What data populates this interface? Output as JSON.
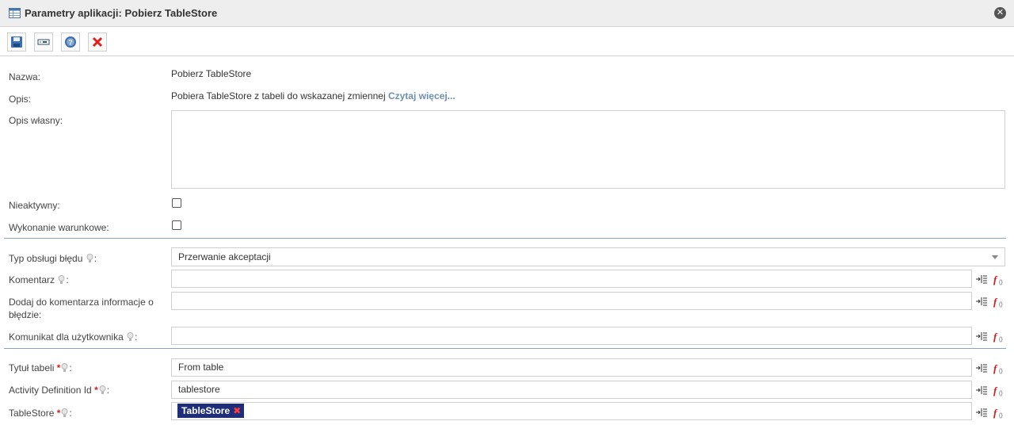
{
  "window": {
    "title": "Parametry aplikacji: Pobierz TableStore",
    "close_glyph": "✕"
  },
  "toolbar": {
    "buttons": [
      {
        "name": "save-button",
        "icon": "floppy-disk-icon"
      },
      {
        "name": "rename-button",
        "icon": "text-field-icon"
      },
      {
        "name": "help-button",
        "icon": "question-icon"
      },
      {
        "name": "delete-button",
        "icon": "red-x-icon"
      }
    ]
  },
  "form": {
    "name_label": "Nazwa:",
    "name_value": "Pobierz TableStore",
    "desc_label": "Opis:",
    "desc_value": "Pobiera TableStore z tabeli do wskazanej zmiennej",
    "desc_link": "Czytaj więcej...",
    "own_desc_label": "Opis własny:",
    "own_desc_value": "",
    "inactive_label": "Nieaktywny:",
    "conditional_label": "Wykonanie warunkowe:",
    "error_type_label": "Typ obsługi błędu",
    "error_type_value": "Przerwanie akceptacji",
    "comment_label": "Komentarz",
    "add_error_info_label_1": "Dodaj do komentarza informacje o",
    "add_error_info_label_2": "błędzie:",
    "user_message_label": "Komunikat dla użytkownika",
    "table_title_label": "Tytuł tabeli",
    "table_title_value": "From table",
    "activity_def_label": "Activity Definition Id",
    "activity_def_value": "tablestore",
    "tablestore_label": "TableStore",
    "tablestore_tag": "TableStore",
    "tag_remove_glyph": "✖",
    "required_mark": "*",
    "colon": ":"
  },
  "colors": {
    "accent_link": "#6d8fb0",
    "divider": "#8aa4bd",
    "tag_bg": "#1f2e7a",
    "required": "#d32020"
  }
}
